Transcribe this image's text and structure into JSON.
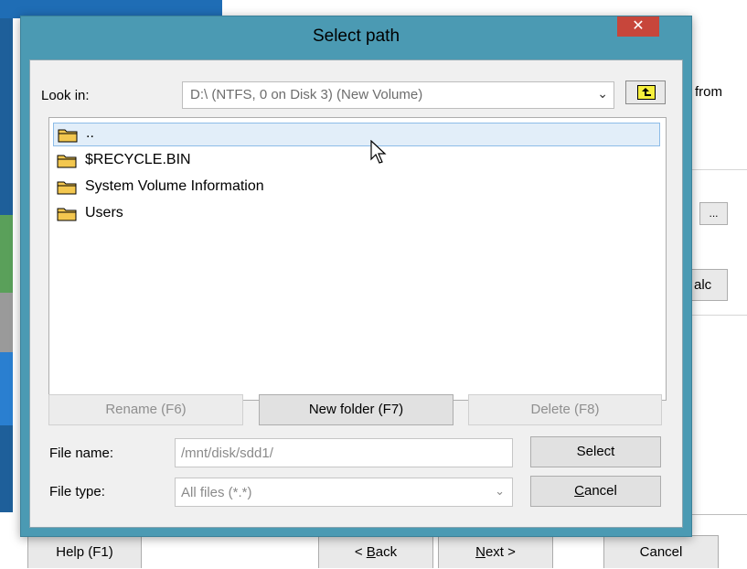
{
  "background": {
    "from_text": "from",
    "browse_label": "...",
    "calc_label": "alc",
    "buttons": {
      "help": "Help (F1)",
      "back_prefix": "< ",
      "back_key": "B",
      "back_rest": "ack",
      "next_key": "N",
      "next_rest": "ext >",
      "cancel": "Cancel"
    }
  },
  "dialog": {
    "title": "Select path",
    "close_glyph": "✕",
    "look_in_label": "Look in:",
    "look_in_value": "D:\\  (NTFS, 0 on Disk 3) (New Volume)",
    "dropdown_glyph": "⌄",
    "files": [
      {
        "name": "..",
        "selected": true
      },
      {
        "name": "$RECYCLE.BIN",
        "selected": false
      },
      {
        "name": "System Volume Information",
        "selected": false
      },
      {
        "name": "Users",
        "selected": false
      }
    ],
    "buttons": {
      "rename": "Rename (F6)",
      "new_folder": "New folder (F7)",
      "delete": "Delete (F8)",
      "select": "Select",
      "cancel_key": "C",
      "cancel_rest": "ancel"
    },
    "file_name_label": "File name:",
    "file_name_value": "/mnt/disk/sdd1/",
    "file_type_label": "File type:",
    "file_type_value": "All files (*.*)"
  },
  "colors": {
    "dialog_frame": "#4b9ab3",
    "close_button": "#c7463b",
    "selection": "#e2eef9",
    "folder_icon": "#f3c74f"
  }
}
